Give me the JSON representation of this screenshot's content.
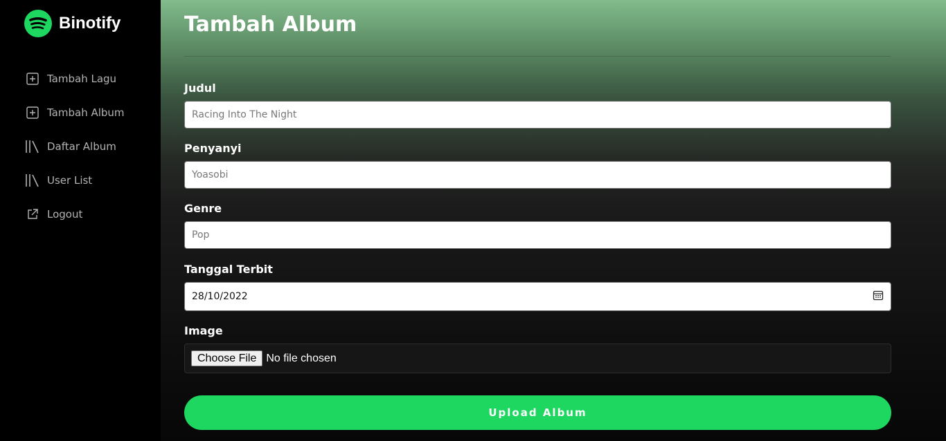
{
  "brand": {
    "name": "Binotify",
    "color": "#1ed760",
    "icon": "spotify-logo-icon"
  },
  "sidebar": {
    "items": [
      {
        "label": "Tambah Lagu",
        "icon": "plus-square-icon"
      },
      {
        "label": "Tambah Album",
        "icon": "plus-square-icon"
      },
      {
        "label": "Daftar Album",
        "icon": "library-icon"
      },
      {
        "label": "User List",
        "icon": "library-icon"
      },
      {
        "label": "Logout",
        "icon": "external-link-icon"
      }
    ]
  },
  "form": {
    "title": "Tambah Album",
    "judul": {
      "label": "Judul",
      "placeholder": "Racing Into The Night"
    },
    "penyanyi": {
      "label": "Penyanyi",
      "placeholder": "Yoasobi"
    },
    "genre": {
      "label": "Genre",
      "placeholder": "Pop"
    },
    "tanggal": {
      "label": "Tanggal Terbit",
      "value": "28/10/2022",
      "icon": "calendar-icon"
    },
    "image": {
      "label": "Image",
      "button_label": "Choose File",
      "status": "No file chosen"
    },
    "submit_label": "Upload Album"
  }
}
